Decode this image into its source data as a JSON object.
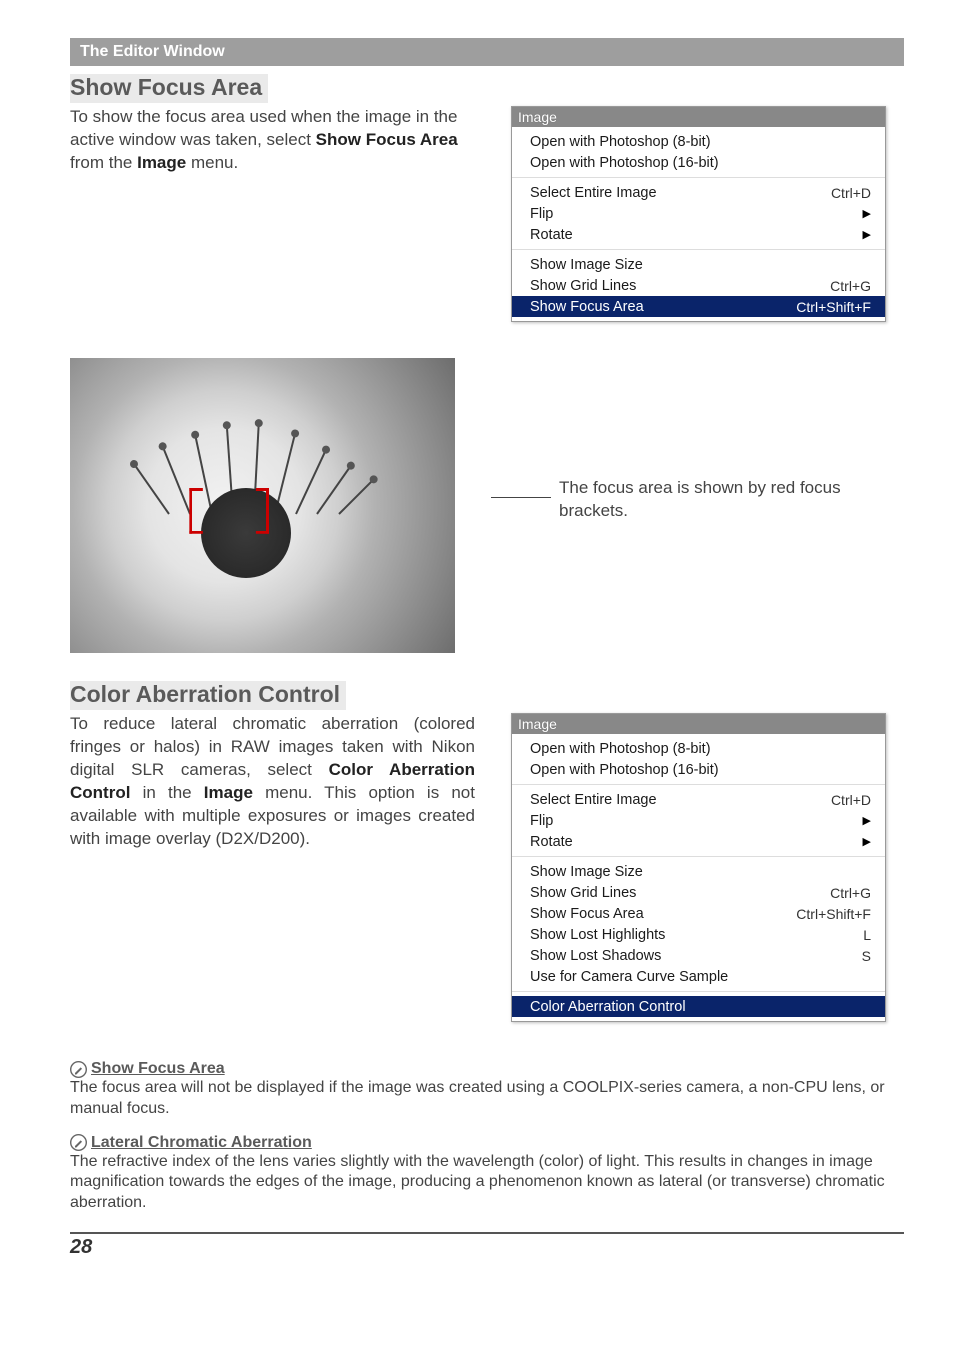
{
  "header_bar": "The Editor Window",
  "section1": {
    "title": "Show Focus Area",
    "body_html": "To show the focus area used when the image in the active window was taken, select <b>Show Focus Area</b> from the <b>Image</b> menu."
  },
  "menu1": {
    "title": "Image",
    "groups": [
      {
        "items": [
          {
            "label": "Open with Photoshop (8-bit)"
          },
          {
            "label": "Open with Photoshop (16-bit)"
          }
        ]
      },
      {
        "items": [
          {
            "label": "Select Entire Image",
            "shortcut": "Ctrl+D"
          },
          {
            "label": "Flip",
            "submenu": true
          },
          {
            "label": "Rotate",
            "submenu": true
          }
        ]
      },
      {
        "items": [
          {
            "label": "Show Image Size"
          },
          {
            "label": "Show Grid Lines",
            "shortcut": "Ctrl+G"
          },
          {
            "label": "Show Focus Area",
            "shortcut": "Ctrl+Shift+F",
            "highlight": true
          }
        ]
      }
    ]
  },
  "caption": "The focus area is shown by red focus brackets.",
  "section2": {
    "title": "Color Aberration Control",
    "body_html": "To reduce lateral chromatic aberration (colored fringes or halos) in RAW images taken with Nikon digital SLR cameras, select <b>Color Aberration Control</b> in the <b>Image</b> menu. This option is not available with multiple exposures or images created with image overlay (D2X/D200)."
  },
  "menu2": {
    "title": "Image",
    "groups": [
      {
        "items": [
          {
            "label": "Open with Photoshop (8-bit)"
          },
          {
            "label": "Open with Photoshop (16-bit)"
          }
        ]
      },
      {
        "items": [
          {
            "label": "Select Entire Image",
            "shortcut": "Ctrl+D"
          },
          {
            "label": "Flip",
            "submenu": true
          },
          {
            "label": "Rotate",
            "submenu": true
          }
        ]
      },
      {
        "items": [
          {
            "label": "Show Image Size"
          },
          {
            "label": "Show Grid Lines",
            "shortcut": "Ctrl+G"
          },
          {
            "label": "Show Focus Area",
            "shortcut": "Ctrl+Shift+F"
          },
          {
            "label": "Show Lost Highlights",
            "shortcut": "L"
          },
          {
            "label": "Show Lost Shadows",
            "shortcut": "S"
          },
          {
            "label": "Use for Camera Curve Sample"
          }
        ]
      },
      {
        "items": [
          {
            "label": "Color Aberration Control",
            "highlight": true
          }
        ]
      }
    ]
  },
  "notes": {
    "n1_title": "Show Focus Area",
    "n1_body": "The focus area will not be displayed if the image was created using a COOLPIX-series camera, a non-CPU lens, or manual focus.",
    "n2_title": "Lateral Chromatic Aberration",
    "n2_body": "The refractive index of the lens varies slightly with the wavelength (color) of light.  This results in changes in image magnification towards the edges of the image, producing a phenomenon known as lateral (or transverse) chromatic aberration."
  },
  "page_number": "28",
  "icons": {
    "pencil": "pencil-icon"
  }
}
